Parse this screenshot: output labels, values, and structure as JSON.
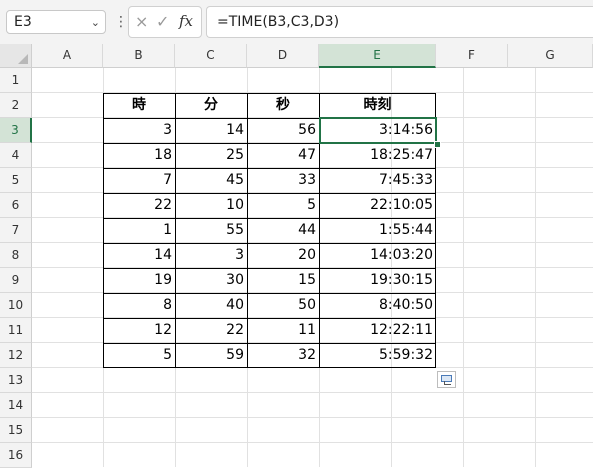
{
  "formula_bar": {
    "name_box": "E3",
    "cancel_icon": "×",
    "enter_icon": "✓",
    "fx_label": "fx",
    "formula": "=TIME(B3,C3,D3)"
  },
  "columns": [
    "A",
    "B",
    "C",
    "D",
    "E",
    "F",
    "G"
  ],
  "rows": [
    "1",
    "2",
    "3",
    "4",
    "5",
    "6",
    "7",
    "8",
    "9",
    "10",
    "11",
    "12",
    "13",
    "14",
    "15",
    "16"
  ],
  "selected_cell": "E3",
  "table": {
    "headers": [
      "時",
      "分",
      "秒",
      "時刻"
    ],
    "data": [
      [
        "3",
        "14",
        "56",
        "3:14:56"
      ],
      [
        "18",
        "25",
        "47",
        "18:25:47"
      ],
      [
        "7",
        "45",
        "33",
        "7:45:33"
      ],
      [
        "22",
        "10",
        "5",
        "22:10:05"
      ],
      [
        "1",
        "55",
        "44",
        "1:55:44"
      ],
      [
        "14",
        "3",
        "20",
        "14:03:20"
      ],
      [
        "19",
        "30",
        "15",
        "19:30:15"
      ],
      [
        "8",
        "40",
        "50",
        "8:40:50"
      ],
      [
        "12",
        "22",
        "11",
        "12:22:11"
      ],
      [
        "5",
        "59",
        "32",
        "5:59:32"
      ]
    ]
  },
  "colors": {
    "accent": "#217346",
    "header_bg": "#f3f3f3"
  }
}
